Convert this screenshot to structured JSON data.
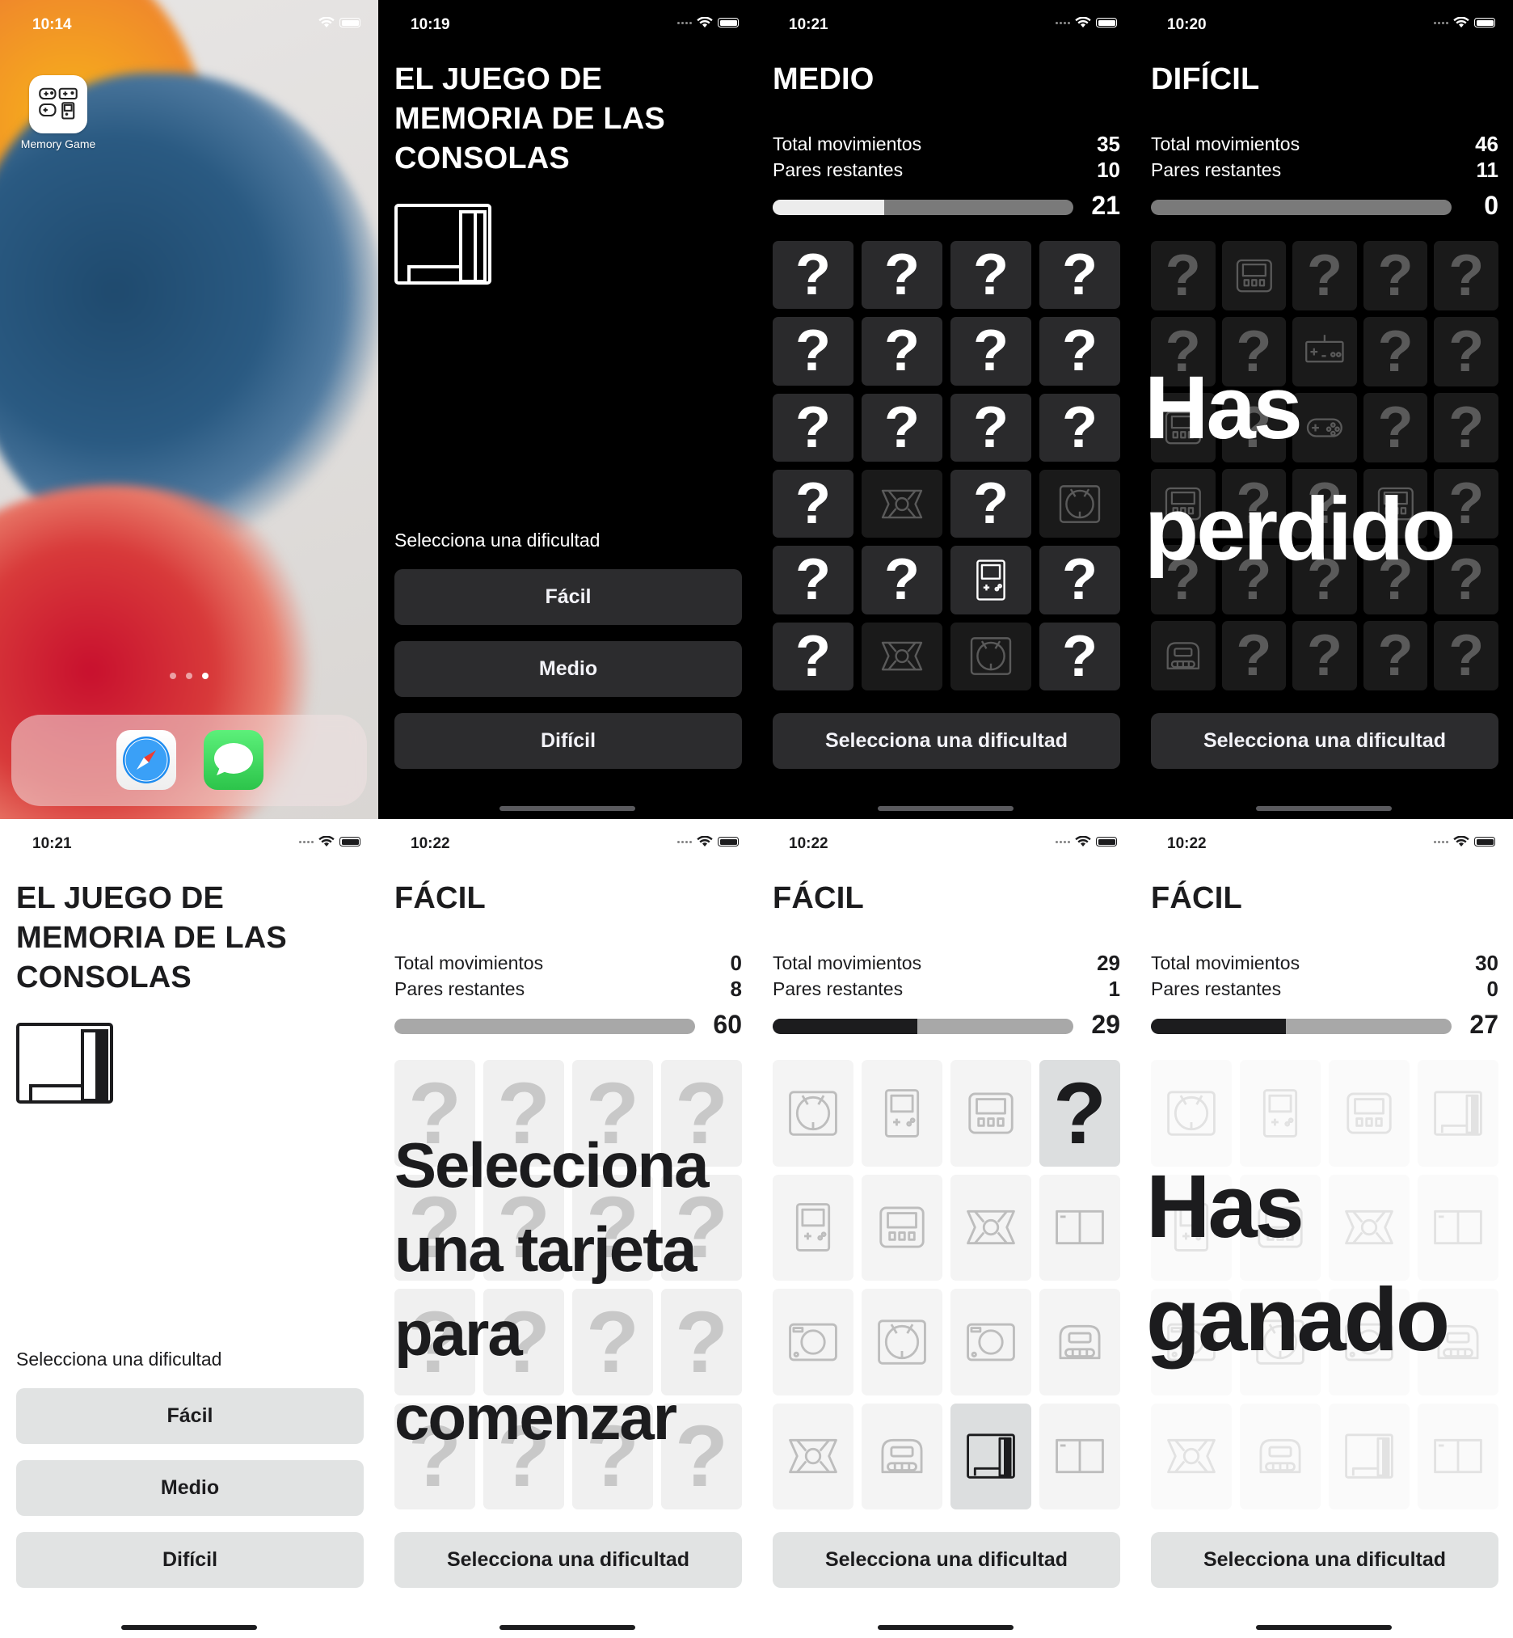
{
  "homescreen": {
    "time": "10:14",
    "app_label": "Memory Game",
    "app_icon": "gamepads-icon",
    "dock_apps": [
      "safari-icon",
      "messages-icon"
    ]
  },
  "dark_menu": {
    "time": "10:19",
    "title": "EL JUEGO DE MEMORIA DE LAS CONSOLAS",
    "select_label": "Selecciona una dificultad",
    "buttons": [
      "Fácil",
      "Medio",
      "Difícil"
    ]
  },
  "dark_medium": {
    "time": "10:21",
    "title": "MEDIO",
    "moves_label": "Total movimientos",
    "moves": "35",
    "pairs_label": "Pares restantes",
    "pairs": "10",
    "timer": "21",
    "progress": 0.37,
    "footer_button": "Selecciona una dificultad",
    "cards": [
      "?",
      "?",
      "?",
      "?",
      "?",
      "?",
      "?",
      "?",
      "?",
      "?",
      "?",
      "?",
      "?",
      "xbox",
      "?",
      "dreamcast",
      "?",
      "?",
      "gameboy",
      "?",
      "?",
      "xbox",
      "dreamcast",
      "?"
    ]
  },
  "dark_hard": {
    "time": "10:20",
    "title": "DIFÍCIL",
    "moves_label": "Total movimientos",
    "moves": "46",
    "pairs_label": "Pares restantes",
    "pairs": "11",
    "timer": "0",
    "progress": 0,
    "overlay": "Has perdido",
    "footer_button": "Selecciona una dificultad",
    "cards": [
      "?",
      "gameboy-advance",
      "?",
      "?",
      "?",
      "?",
      "?",
      "nes-controller",
      "?",
      "?",
      "gameboy-advance",
      "?",
      "snes-controller",
      "?",
      "?",
      "gameboy-advance",
      "?",
      "?",
      "gameboy-advance",
      "?",
      "?",
      "?",
      "?",
      "?",
      "?",
      "n64",
      "?",
      "?",
      "?",
      "?"
    ]
  },
  "light_menu": {
    "time": "10:21",
    "title": "EL JUEGO DE MEMORIA DE LAS CONSOLAS",
    "select_label": "Selecciona una dificultad",
    "buttons": [
      "Fácil",
      "Medio",
      "Difícil"
    ]
  },
  "light_easy_start": {
    "time": "10:22",
    "title": "FÁCIL",
    "moves_label": "Total movimientos",
    "moves": "0",
    "pairs_label": "Pares restantes",
    "pairs": "8",
    "timer": "60",
    "progress": 0,
    "overlay": "Selecciona una tarjeta para comenzar",
    "footer_button": "Selecciona una dificultad",
    "cards": [
      "?",
      "?",
      "?",
      "?",
      "?",
      "?",
      "?",
      "?",
      "?",
      "?",
      "?",
      "?",
      "?",
      "?",
      "?",
      "?"
    ]
  },
  "light_easy_mid": {
    "time": "10:22",
    "title": "FÁCIL",
    "moves_label": "Total movimientos",
    "moves": "29",
    "pairs_label": "Pares restantes",
    "pairs": "1",
    "timer": "29",
    "progress": 0.48,
    "footer_button": "Selecciona una dificultad",
    "cards": [
      "dreamcast",
      "gameboy",
      "gameboy-advance",
      "?",
      "gameboy",
      "gameboy-advance",
      "xbox",
      "wii",
      "playstation",
      "dreamcast",
      "playstation",
      "n64",
      "xbox",
      "n64",
      "nes",
      "wii"
    ]
  },
  "light_easy_won": {
    "time": "10:22",
    "title": "FÁCIL",
    "moves_label": "Total movimientos",
    "moves": "30",
    "pairs_label": "Pares restantes",
    "pairs": "0",
    "timer": "27",
    "progress": 0.45,
    "overlay": "Has ganado",
    "footer_button": "Selecciona una dificultad",
    "cards": [
      "dreamcast",
      "gameboy",
      "gameboy-advance",
      "nes",
      "gameboy",
      "gameboy-advance",
      "xbox",
      "wii",
      "playstation",
      "dreamcast",
      "playstation",
      "n64",
      "xbox",
      "n64",
      "nes",
      "wii"
    ]
  }
}
